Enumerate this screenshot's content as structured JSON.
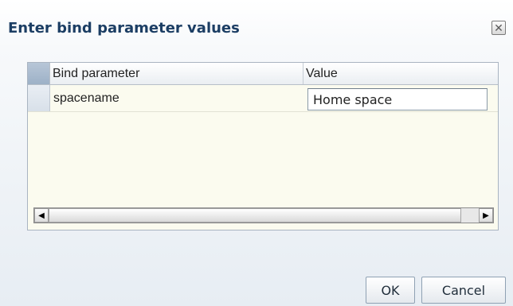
{
  "dialog": {
    "title": "Enter bind parameter values",
    "close_icon": "close-icon"
  },
  "table": {
    "columns": [
      "Bind parameter",
      "Value"
    ],
    "rows": [
      {
        "parameter": "spacename",
        "value": "Home space"
      }
    ]
  },
  "scrollbar": {
    "left_arrow": "◀",
    "right_arrow": "▶"
  },
  "buttons": {
    "ok": "OK",
    "cancel": "Cancel"
  }
}
